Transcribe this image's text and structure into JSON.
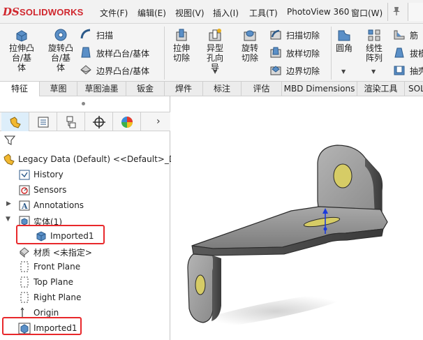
{
  "menubar": {
    "logo_mark": "DS",
    "logo_text": "SOLIDWORKS",
    "items": [
      {
        "label": "文件(F)"
      },
      {
        "label": "编辑(E)"
      },
      {
        "label": "视图(V)"
      },
      {
        "label": "插入(I)"
      },
      {
        "label": "工具(T)"
      },
      {
        "label": "PhotoView 360"
      },
      {
        "label": "窗口(W)"
      }
    ]
  },
  "ribbon": {
    "extrude_boss": "拉伸凸台/基体",
    "revolve_boss": "旋转凸台/基体",
    "sweep": "扫描",
    "loft_boss": "放样凸台/基体",
    "boundary_boss": "边界凸台/基体",
    "extrude_cut": "拉伸切除",
    "hole_wizard": "异型孔向导",
    "revolve_cut": "旋转切除",
    "sweep_cut": "扫描切除",
    "loft_cut": "放样切除",
    "boundary_cut": "边界切除",
    "fillet": "圆角",
    "linear_pattern": "线性阵列",
    "rib": "筋",
    "draft": "拔模",
    "shell": "抽壳"
  },
  "tabs": [
    {
      "label": "特征"
    },
    {
      "label": "草图"
    },
    {
      "label": "草图油墨"
    },
    {
      "label": "钣金"
    },
    {
      "label": "焊件"
    },
    {
      "label": "标注"
    },
    {
      "label": "评估"
    },
    {
      "label": "MBD Dimensions"
    },
    {
      "label": "渲染工具"
    },
    {
      "label": "SOL"
    }
  ],
  "tree": {
    "root": "Legacy Data (Default) <<Default>_Di",
    "history": "History",
    "sensors": "Sensors",
    "annotations": "Annotations",
    "solid_bodies": "实体(1)",
    "body_item": "Imported1",
    "material": "材质 <未指定>",
    "front_plane": "Front Plane",
    "top_plane": "Top Plane",
    "right_plane": "Right Plane",
    "origin": "Origin",
    "feature": "Imported1"
  },
  "colors": {
    "highlight": "#e8282b",
    "brand": "#d0262d"
  }
}
